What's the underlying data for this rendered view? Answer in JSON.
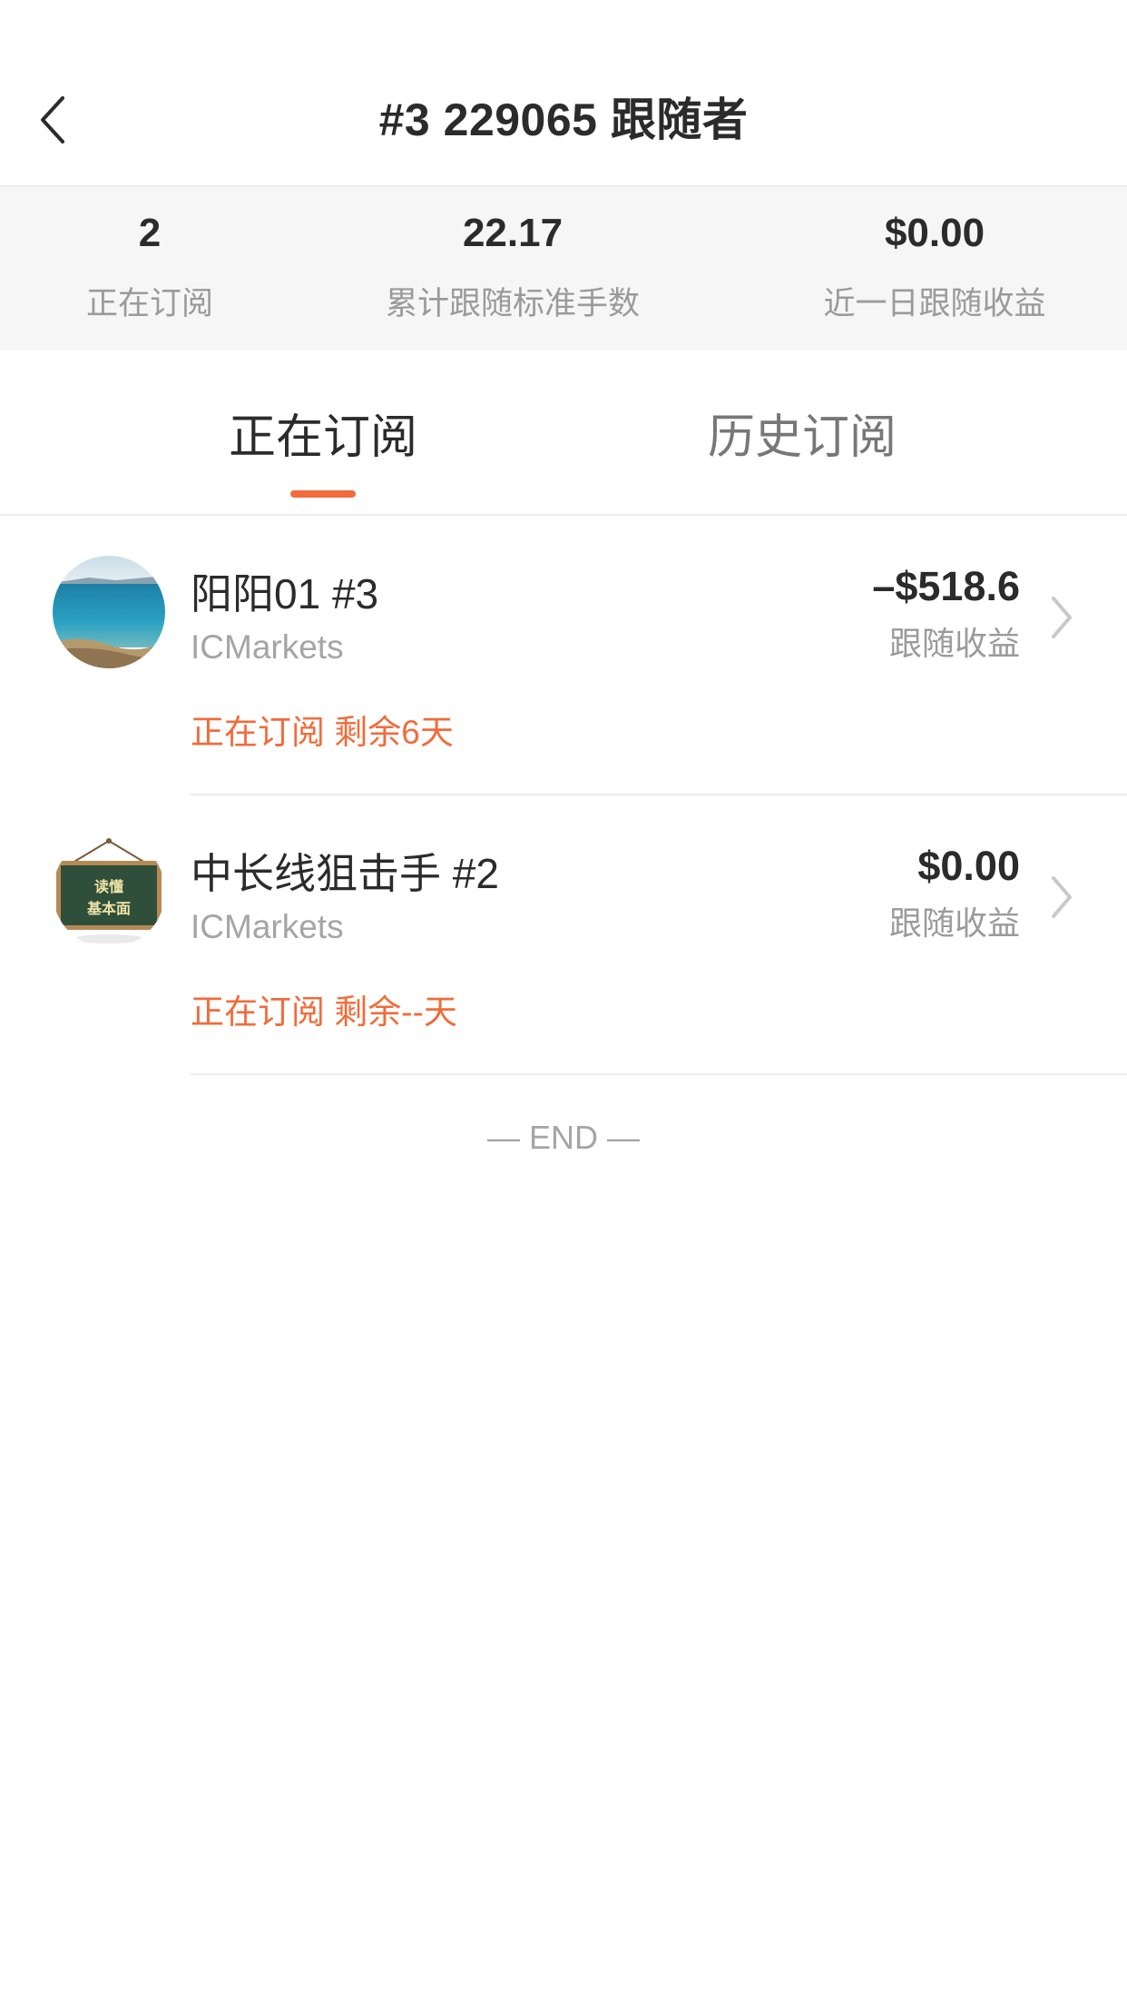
{
  "header": {
    "title": "#3 229065 跟随者",
    "back_icon": "chevron-left-icon"
  },
  "stats": [
    {
      "value": "2",
      "label": "正在订阅"
    },
    {
      "value": "22.17",
      "label": "累计跟随标准手数"
    },
    {
      "value": "$0.00",
      "label": "近一日跟随收益"
    }
  ],
  "tabs": [
    {
      "label": "正在订阅",
      "active": true
    },
    {
      "label": "历史订阅",
      "active": false
    }
  ],
  "subscriptions": [
    {
      "name": "阳阳01 #3",
      "broker": "ICMarkets",
      "status": "正在订阅 剩余6天",
      "amount": "–$518.6",
      "amount_label": "跟随收益",
      "avatar": "sea-avatar"
    },
    {
      "name": "中长线狙击手 #2",
      "broker": "ICMarkets",
      "status": "正在订阅 剩余--天",
      "amount": "$0.00",
      "amount_label": "跟随收益",
      "avatar": "chalkboard-avatar",
      "avatar_text_1": "读懂",
      "avatar_text_2": "基本面"
    }
  ],
  "end_text": "— END —",
  "colors": {
    "accent": "#f26b3a",
    "stats_bg": "#f6f6f6",
    "divider": "#ececec"
  }
}
